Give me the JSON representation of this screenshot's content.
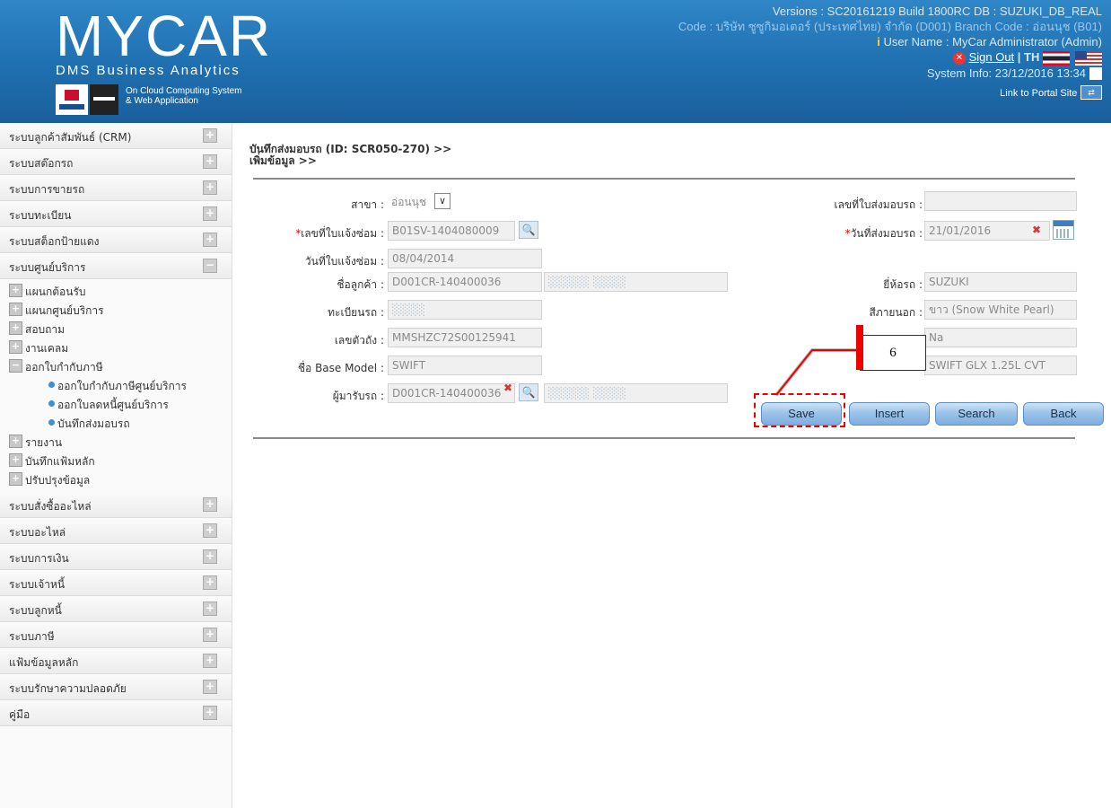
{
  "header": {
    "logo_title": "MYCAR",
    "logo_subtitle": "DMS Business Analytics",
    "tagline_1": "On Cloud Computing System",
    "tagline_2": "& Web Application",
    "version_line": "Versions : SC20161219 Build 1800RC DB : SUZUKI_DB_REAL",
    "company_line": "Code : บริษัท ซูซูกิมอเตอร์ (ประเทศไทย) จำกัด (D001)  Branch Code : อ่อนนุช (B01)",
    "user_line": "User Name : MyCar Administrator  (Admin)",
    "sign_out": "Sign Out",
    "lang": "| TH",
    "system_info": "System Info: 23/12/2016 13:34",
    "portal_link": "Link to Portal Site"
  },
  "sidebar": {
    "top_items": [
      {
        "label": "ระบบลูกค้าสัมพันธ์ (CRM)",
        "sign": "+"
      },
      {
        "label": "ระบบสต๊อกรถ",
        "sign": "+"
      },
      {
        "label": "ระบบการขายรถ",
        "sign": "+"
      },
      {
        "label": "ระบบทะเบียน",
        "sign": "+"
      },
      {
        "label": "ระบบสต็อกป้ายแดง",
        "sign": "+"
      },
      {
        "label": "ระบบศูนย์บริการ",
        "sign": "−"
      }
    ],
    "sub_items": [
      {
        "label": "แผนกต้อนรับ",
        "sign": "+"
      },
      {
        "label": "แผนกศูนย์บริการ",
        "sign": "+"
      },
      {
        "label": "สอบถาม",
        "sign": "+"
      },
      {
        "label": "งานเคลม",
        "sign": "+"
      },
      {
        "label": "ออกใบกำกับภาษี",
        "sign": "−"
      }
    ],
    "leaf_items": [
      {
        "label": "ออกใบกำกับภาษีศูนย์บริการ"
      },
      {
        "label": "ออกใบลดหนี้ศูนย์บริการ"
      },
      {
        "label": "บันทึกส่งมอบรถ"
      }
    ],
    "sub_items_2": [
      {
        "label": "รายงาน",
        "sign": "+"
      },
      {
        "label": "บันทึกแฟ้มหลัก",
        "sign": "+"
      },
      {
        "label": "ปรับปรุงข้อมูล",
        "sign": "+"
      }
    ],
    "bottom_items": [
      {
        "label": "ระบบสั่งซื้ออะไหล่",
        "sign": "+"
      },
      {
        "label": "ระบบอะไหล่",
        "sign": "+"
      },
      {
        "label": "ระบบการเงิน",
        "sign": "+"
      },
      {
        "label": "ระบบเจ้าหนี้",
        "sign": "+"
      },
      {
        "label": "ระบบลูกหนี้",
        "sign": "+"
      },
      {
        "label": "ระบบภาษี",
        "sign": "+"
      },
      {
        "label": "แฟ้มข้อมูลหลัก",
        "sign": "+"
      },
      {
        "label": "ระบบรักษาความปลอดภัย",
        "sign": "+"
      },
      {
        "label": "คู่มือ",
        "sign": "+"
      }
    ]
  },
  "page": {
    "title_line1": "บันทึกส่งมอบรถ (ID: SCR050-270) >>",
    "title_line2": "เพิ่มข้อมูล >>"
  },
  "form": {
    "branch_label": "สาขา :",
    "branch_value": "อ่อนนุช",
    "delivery_no_label": "เลขที่ใบส่งมอบรถ :",
    "delivery_no_value": "",
    "repair_no_label": "เลขที่ใบแจ้งซ่อม :",
    "repair_no_value": "B01SV-1404080009",
    "delivery_date_label": "วันที่ส่งมอบรถ :",
    "delivery_date_value": "21/01/2016",
    "repair_date_label": "วันที่ใบแจ้งซ่อม :",
    "repair_date_value": "08/04/2014",
    "customer_label": "ชื่อลูกค้า :",
    "customer_code": "D001CR-140400036",
    "brand_label": "ยี่ห้อรถ :",
    "brand_value": "SUZUKI",
    "plate_label": "ทะเบียนรถ :",
    "exterior_color_label": "สีภายนอก :",
    "exterior_color_value": "ขาว (Snow White Pearl)",
    "chassis_label": "เลขตัวถัง :",
    "chassis_value": "MMSHZC72S00125941",
    "interior_value": "Na",
    "base_model_label": "ชื่อ Base Model :",
    "base_model_value": "SWIFT",
    "model_value": "SWIFT GLX 1.25L CVT",
    "receiver_label": "ผู้มารับรถ :",
    "receiver_code": "D001CR-140400036"
  },
  "buttons": {
    "save": "Save",
    "insert": "Insert",
    "search": "Search",
    "back": "Back"
  },
  "annotation": {
    "step_number": "6"
  }
}
